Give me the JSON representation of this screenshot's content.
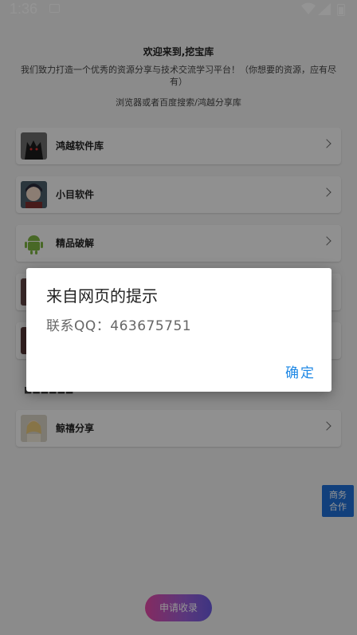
{
  "status_bar": {
    "time": "1:36"
  },
  "page": {
    "title": "欢迎来到,挖宝库",
    "description": "我们致力打造一个优秀的资源分享与技术交流学习平台！（你想要的资源，应有尽有）",
    "subline": "浏览器或者百度搜索/鸿越分享库",
    "items": [
      {
        "label": "鸿越软件库",
        "thumb_icon": "cat-avatar-icon"
      },
      {
        "label": "小目软件",
        "thumb_icon": "anime-avatar-icon"
      },
      {
        "label": "精品破解",
        "thumb_icon": "android-robot-icon"
      },
      {
        "label": "鲸禧分享",
        "thumb_icon": "portrait-avatar-icon"
      }
    ],
    "float_button": {
      "line1": "商务",
      "line2": "合作"
    },
    "apply_button": "申请收录"
  },
  "dialog": {
    "title": "来自网页的提示",
    "message": "联系QQ：463675751",
    "ok_label": "确定"
  },
  "colors": {
    "accent": "#1e88e5",
    "float_button": "#1f6fd6"
  }
}
